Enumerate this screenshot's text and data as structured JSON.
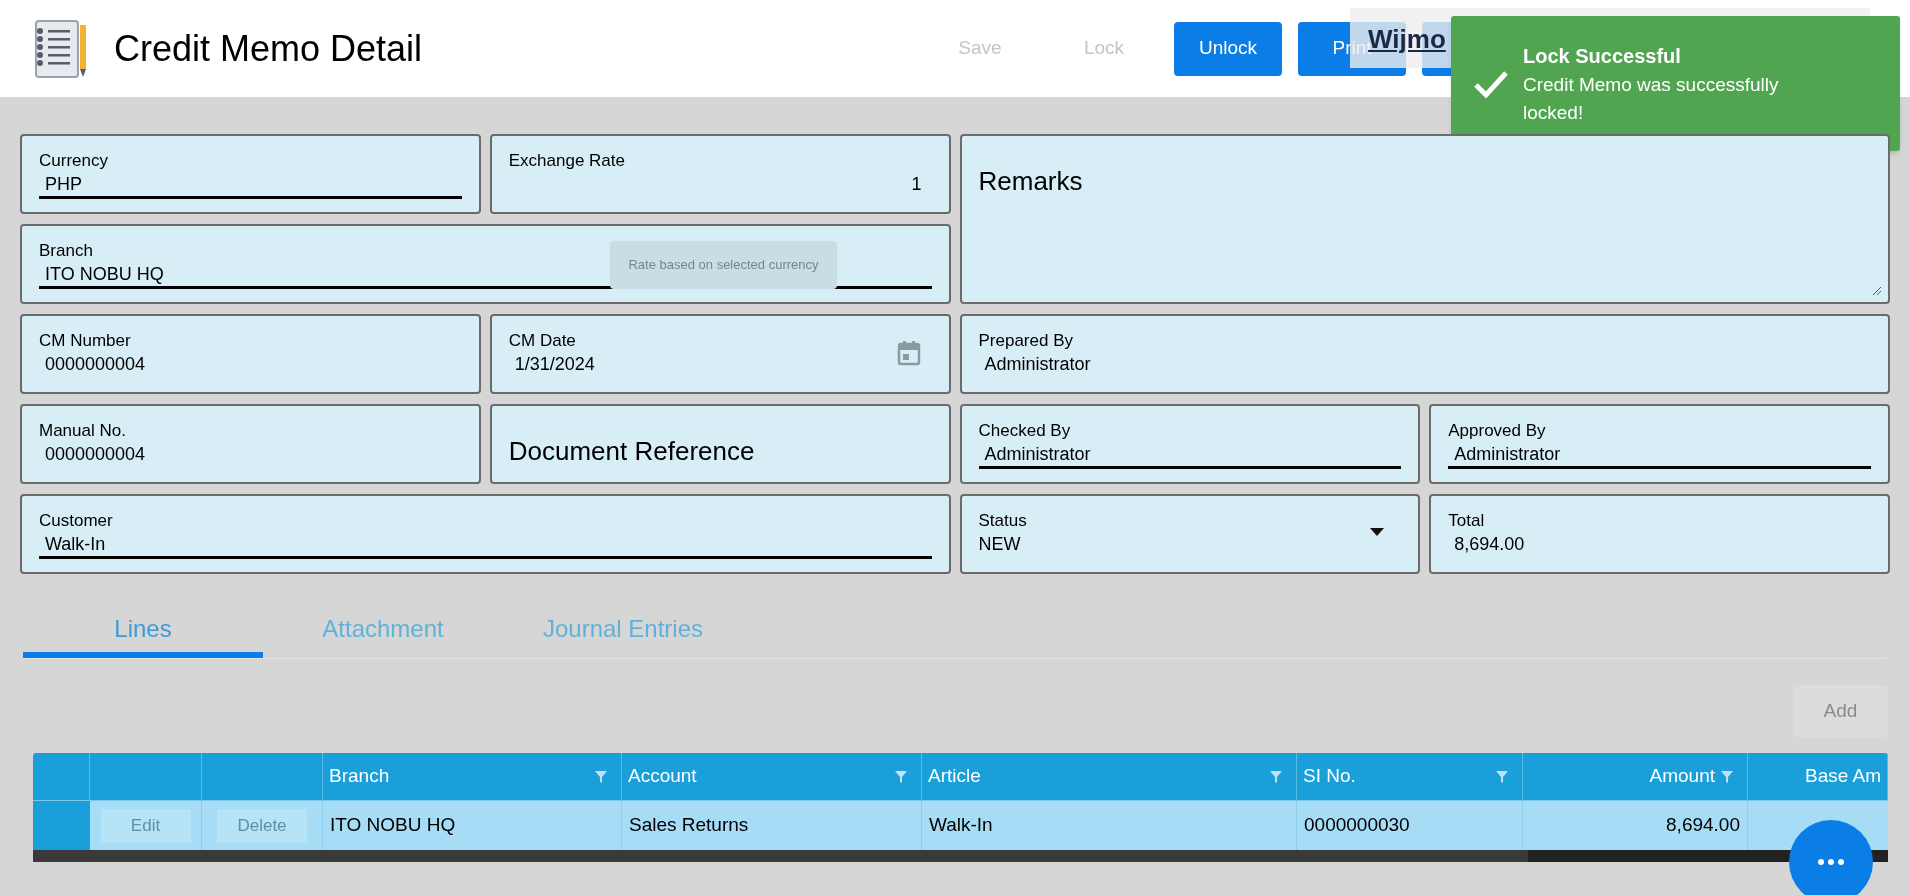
{
  "header": {
    "title": "Credit Memo Detail"
  },
  "toolbar": [
    {
      "label": "Save",
      "disabled": true
    },
    {
      "label": "Lock",
      "disabled": true
    },
    {
      "label": "Unlock",
      "disabled": false
    },
    {
      "label": "Print",
      "disabled": false
    }
  ],
  "overlay_link": "Wijmo",
  "toast": {
    "title": "Lock Successful",
    "message": "Credit Memo was successfully locked!"
  },
  "fields": [
    {
      "kind": "select",
      "label": "Currency",
      "value": "PHP"
    },
    {
      "kind": "number",
      "label": "Exchange Rate",
      "value": "1"
    },
    {
      "kind": "textarea",
      "label": "Remarks"
    },
    {
      "kind": "select",
      "label": "Branch",
      "value": "ITO NOBU HQ"
    },
    {
      "kind": "text",
      "label": "CM Number",
      "value": "0000000004"
    },
    {
      "kind": "date",
      "label": "CM Date",
      "value": "1/31/2024"
    },
    {
      "kind": "text",
      "label": "Prepared By",
      "value": "Administrator"
    },
    {
      "kind": "text",
      "label": "Manual No.",
      "value": "0000000004"
    },
    {
      "kind": "heading",
      "label": "Document Reference"
    },
    {
      "kind": "select",
      "label": "Checked By",
      "value": "Administrator"
    },
    {
      "kind": "select",
      "label": "Approved By",
      "value": "Administrator"
    },
    {
      "kind": "select",
      "label": "Customer",
      "value": "Walk-In"
    },
    {
      "kind": "dropdown",
      "label": "Status",
      "value": "NEW"
    },
    {
      "kind": "text",
      "label": "Total",
      "value": "8,694.00"
    }
  ],
  "rate_tooltip": "Rate based on selected currency",
  "tabs": [
    {
      "label": "Lines",
      "selected": true
    },
    {
      "label": "Attachment",
      "selected": false
    },
    {
      "label": "Journal Entries",
      "selected": false
    }
  ],
  "add_button": {
    "label": "Add",
    "disabled": true
  },
  "table": {
    "columns": [
      {
        "label": "Branch",
        "kind": "text",
        "filter": true
      },
      {
        "label": "Account",
        "kind": "text",
        "filter": true
      },
      {
        "label": "Article",
        "kind": "text",
        "filter": true
      },
      {
        "label": "SI No.",
        "kind": "text",
        "filter": true
      },
      {
        "label": "Amount",
        "kind": "number",
        "filter": true
      },
      {
        "label": "Base Am",
        "kind": "number",
        "filter": false
      }
    ],
    "rows": [
      {
        "actions": [
          "Edit",
          "Delete"
        ],
        "cells": [
          "ITO NOBU HQ",
          "Sales Returns",
          "Walk-In",
          "0000000030",
          "8,694.00"
        ]
      }
    ]
  }
}
